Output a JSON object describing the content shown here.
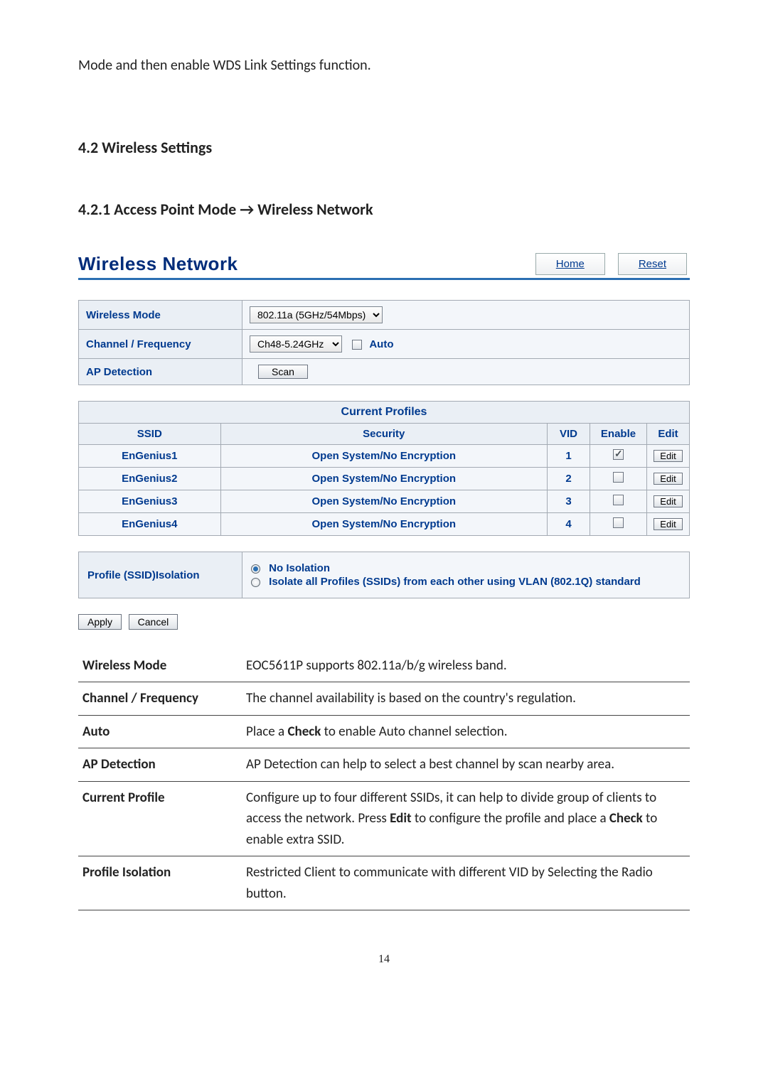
{
  "intro": "Mode and then enable WDS Link Settings function.",
  "section_4_2": "4.2 Wireless Settings",
  "section_4_2_1": "4.2.1 Access Point Mode → Wireless Network",
  "page_number": "14",
  "panel": {
    "title": "Wireless Network",
    "home": "Home",
    "reset": "Reset",
    "rows": {
      "wireless_mode_label": "Wireless Mode",
      "wireless_mode_value": "802.11a (5GHz/54Mbps)",
      "channel_label": "Channel / Frequency",
      "channel_value": "Ch48-5.24GHz",
      "auto_label": "Auto",
      "ap_detection_label": "AP Detection",
      "scan_label": "Scan"
    }
  },
  "profiles": {
    "caption": "Current Profiles",
    "headers": {
      "ssid": "SSID",
      "security": "Security",
      "vid": "VID",
      "enable": "Enable",
      "edit": "Edit"
    },
    "edit_label": "Edit",
    "rows": [
      {
        "ssid": "EnGenius1",
        "security": "Open System/No Encryption",
        "vid": "1",
        "enabled": true
      },
      {
        "ssid": "EnGenius2",
        "security": "Open System/No Encryption",
        "vid": "2",
        "enabled": false
      },
      {
        "ssid": "EnGenius3",
        "security": "Open System/No Encryption",
        "vid": "3",
        "enabled": false
      },
      {
        "ssid": "EnGenius4",
        "security": "Open System/No Encryption",
        "vid": "4",
        "enabled": false
      }
    ]
  },
  "isolation": {
    "label": "Profile (SSID)Isolation",
    "opt1": "No Isolation",
    "opt2": "Isolate all Profiles (SSIDs) from each other using VLAN (802.1Q) standard",
    "selected": 0
  },
  "buttons": {
    "apply": "Apply",
    "cancel": "Cancel"
  },
  "descriptions": [
    {
      "k": "Wireless Mode",
      "v": "EOC5611P supports 802.11a/b/g wireless band."
    },
    {
      "k": "Channel / Frequency",
      "v": "The channel availability is based on the country's regulation."
    },
    {
      "k": "Auto",
      "v_pre": "Place a ",
      "v_bold": "Check",
      "v_post": " to enable Auto channel selection."
    },
    {
      "k": "AP Detection",
      "v": "AP Detection can help to select a best channel by scan nearby area."
    },
    {
      "k": "Current Profile",
      "v_parts": [
        "Configure up to four different SSIDs, it can help to divide group of clients to access the network. Press ",
        "Edit",
        " to configure the profile and place a ",
        "Check",
        " to enable extra SSID."
      ]
    },
    {
      "k": "Profile Isolation",
      "v": "Restricted Client to communicate with different VID by Selecting the Radio button."
    }
  ]
}
